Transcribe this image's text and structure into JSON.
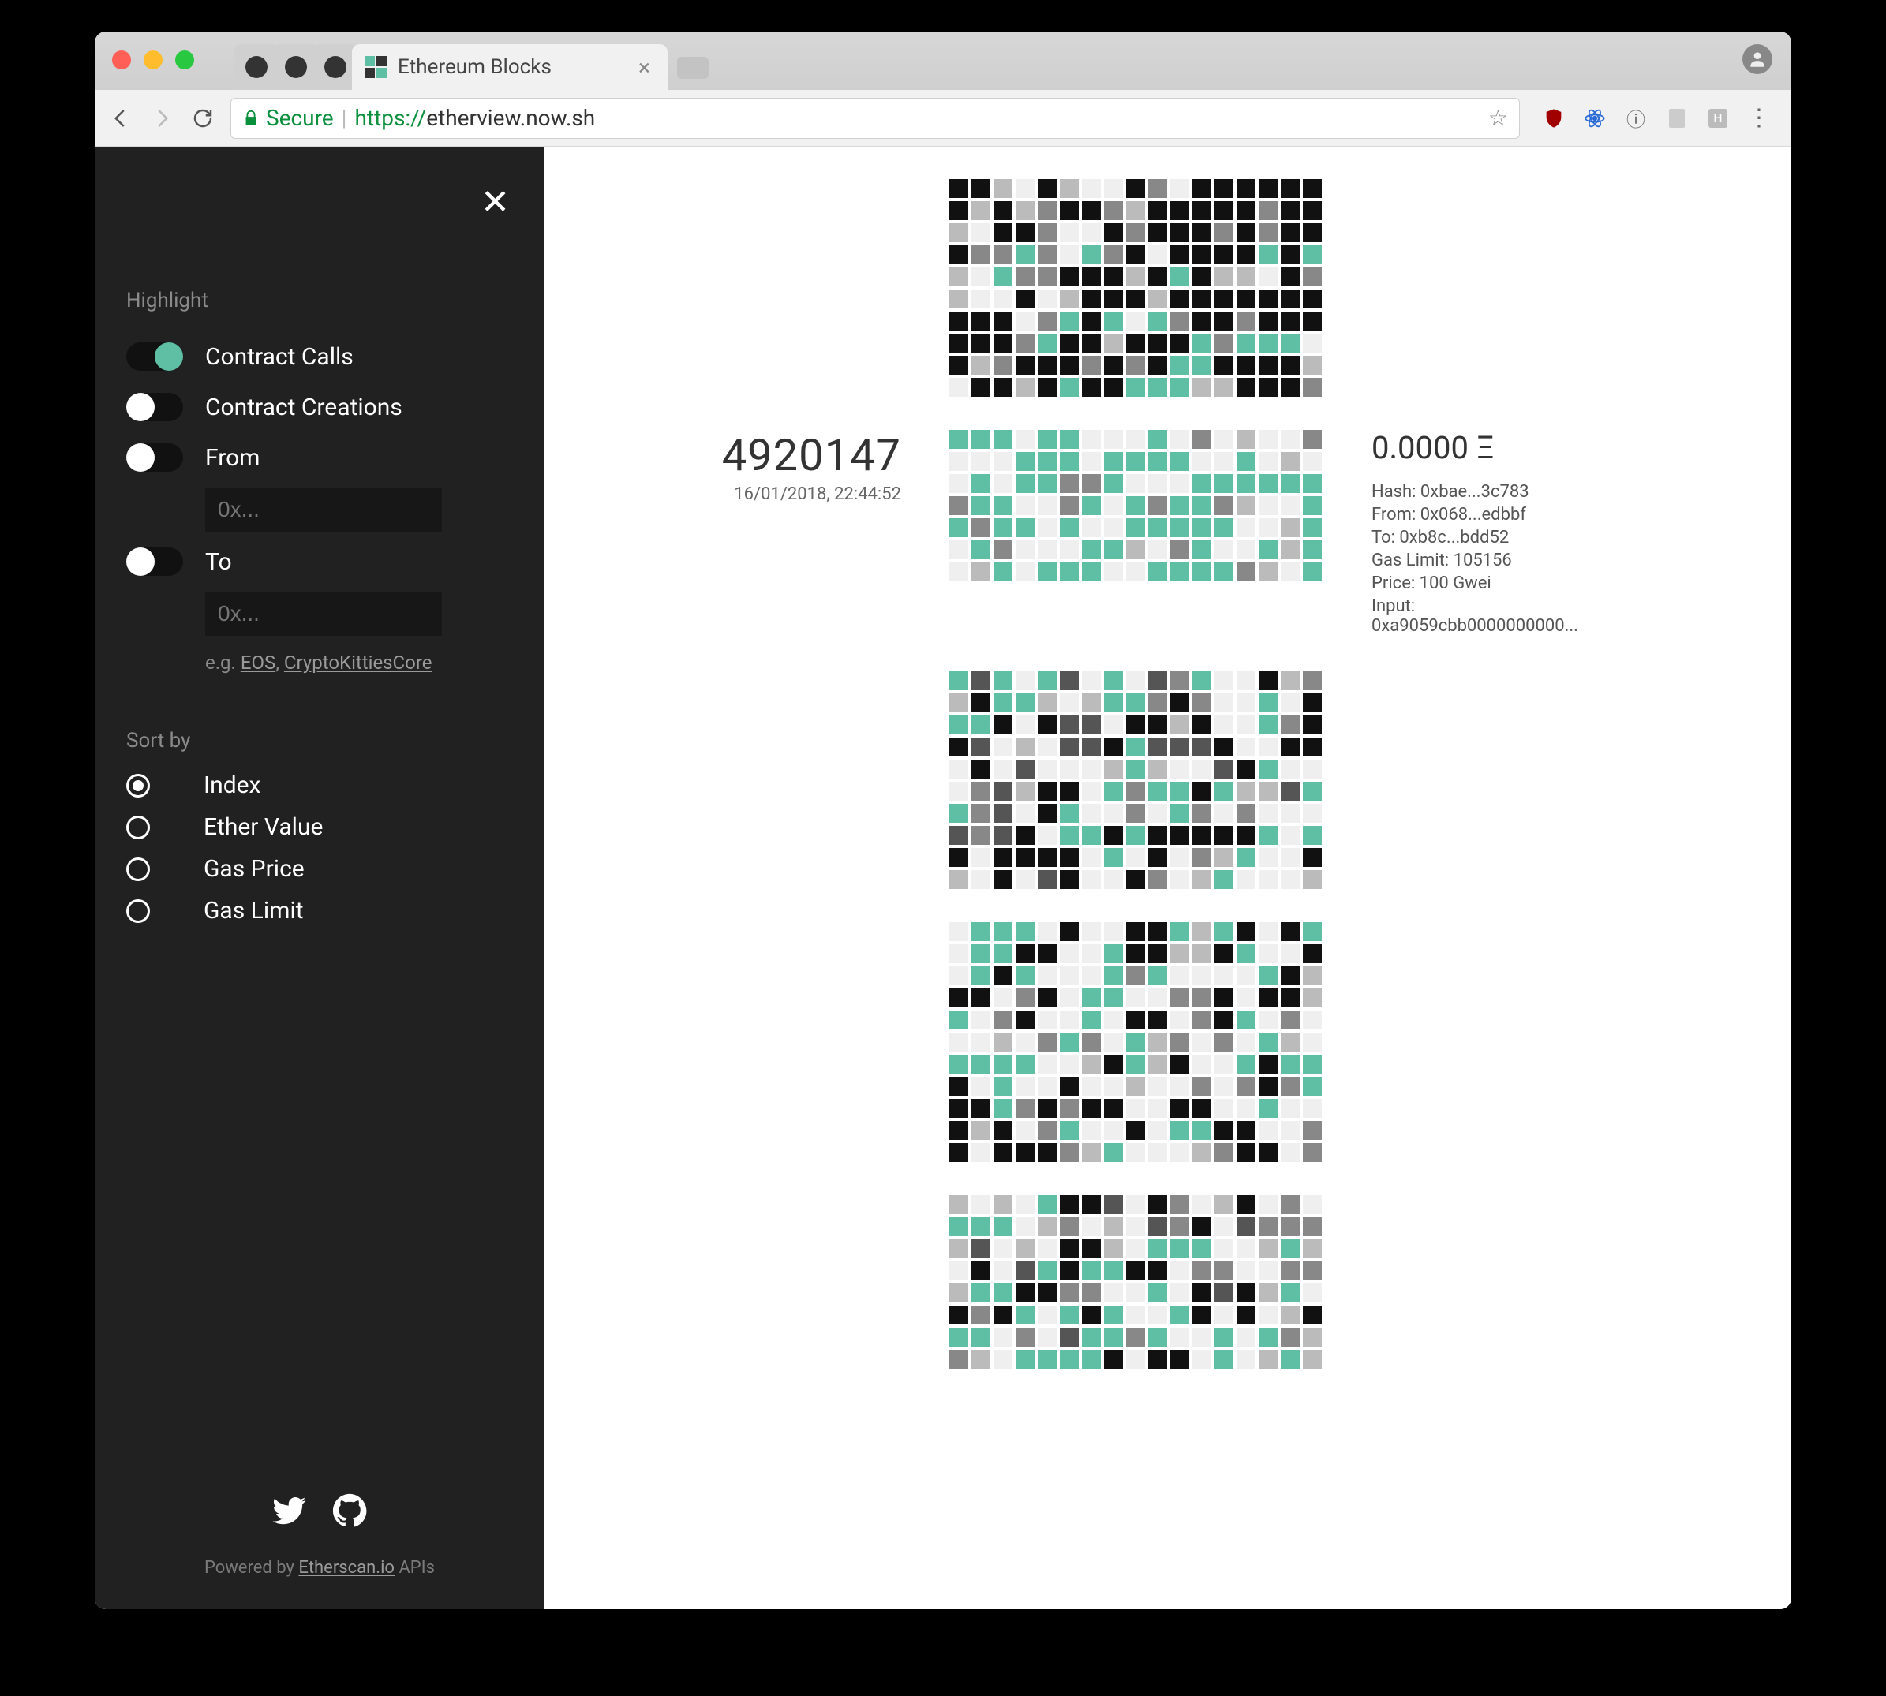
{
  "browser": {
    "tabs": {
      "active_title": "Ethereum Blocks"
    },
    "url": {
      "secure_label": "Secure",
      "protocol": "https://",
      "host_path": "etherview.now.sh"
    }
  },
  "sidebar": {
    "highlight_label": "Highlight",
    "toggles": {
      "contract_calls": "Contract Calls",
      "contract_creations": "Contract Creations",
      "from": "From",
      "to": "To"
    },
    "input_placeholder": "0x...",
    "example_prefix": "e.g. ",
    "example_links": {
      "eos": "EOS",
      "ck": "CryptoKittiesCore"
    },
    "sort_label": "Sort by",
    "sort_options": {
      "index": "Index",
      "ether": "Ether Value",
      "gasprice": "Gas Price",
      "gaslimit": "Gas Limit"
    },
    "footer": {
      "powered_prefix": "Powered by ",
      "powered_link": "Etherscan.io",
      "powered_suffix": " APIs"
    }
  },
  "block": {
    "number": "4920147",
    "timestamp": "16/01/2018, 22:44:52",
    "eth_value": "0.0000 Ξ",
    "hash": "Hash: 0xbae...3c783",
    "from": "From: 0x068...edbbf",
    "to": "To:     0xb8c...bdd52",
    "gaslimit": "Gas Limit: 105156",
    "price": "Price: 100 Gwei",
    "input": "Input: 0xa9059cbb0000000000..."
  },
  "grids": [
    {
      "rows": 10,
      "cols": 17,
      "palette": "dark",
      "seed": 1
    },
    {
      "rows": 7,
      "cols": 17,
      "palette": "teal",
      "seed": 2,
      "meta": true
    },
    {
      "rows": 10,
      "cols": 17,
      "palette": "mixed",
      "seed": 3
    },
    {
      "rows": 11,
      "cols": 17,
      "palette": "light",
      "seed": 4
    },
    {
      "rows": 8,
      "cols": 17,
      "palette": "mixed",
      "seed": 5
    }
  ]
}
